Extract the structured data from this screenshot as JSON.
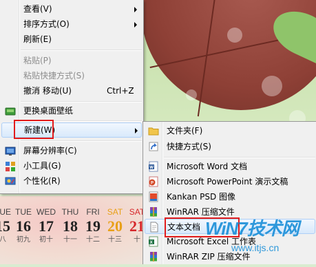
{
  "context_menu": {
    "items": [
      {
        "label": "查看(V)",
        "submenu": true
      },
      {
        "label": "排序方式(O)",
        "submenu": true
      },
      {
        "label": "刷新(E)"
      },
      {
        "label": "粘贴(P)",
        "disabled": true
      },
      {
        "label": "粘贴快捷方式(S)",
        "disabled": true
      },
      {
        "label": "撤消 移动(U)",
        "shortcut": "Ctrl+Z"
      },
      {
        "label": "更换桌面壁纸",
        "icon": "wallpaper-icon"
      },
      {
        "label": "新建(W)",
        "submenu": true,
        "highlighted": true
      },
      {
        "label": "屏幕分辨率(C)",
        "icon": "monitor-icon"
      },
      {
        "label": "小工具(G)",
        "icon": "gadgets-icon"
      },
      {
        "label": "个性化(R)",
        "icon": "personalize-icon"
      }
    ]
  },
  "new_submenu": {
    "items": [
      {
        "label": "文件夹(F)",
        "icon": "folder-icon"
      },
      {
        "label": "快捷方式(S)",
        "icon": "shortcut-icon"
      },
      {
        "label": "Microsoft Word 文档",
        "icon": "word-icon"
      },
      {
        "label": "Microsoft PowerPoint 演示文稿",
        "icon": "powerpoint-icon"
      },
      {
        "label": "Kankan PSD 图像",
        "icon": "psd-icon"
      },
      {
        "label": "WinRAR 压缩文件",
        "icon": "winrar-icon"
      },
      {
        "label": "文本文档",
        "icon": "text-document-icon",
        "highlighted": true
      },
      {
        "label": "Microsoft Excel 工作表",
        "icon": "excel-icon"
      },
      {
        "label": "WinRAR ZIP 压缩文件",
        "icon": "winrar-zip-icon"
      }
    ]
  },
  "calendar": {
    "days": [
      {
        "weekday": "TUE",
        "date": "15",
        "lunar": "八"
      },
      {
        "weekday": "TUE",
        "date": "16",
        "lunar": "初九"
      },
      {
        "weekday": "WED",
        "date": "17",
        "lunar": "初十"
      },
      {
        "weekday": "THU",
        "date": "18",
        "lunar": "十一"
      },
      {
        "weekday": "FRI",
        "date": "19",
        "lunar": "十二"
      },
      {
        "weekday": "SAT",
        "date": "20",
        "lunar": "十三"
      },
      {
        "weekday": "SAT",
        "date": "21",
        "lunar": "十"
      }
    ]
  },
  "watermark": {
    "logo": "WiN7技术网",
    "url": "www.itjs.cn"
  },
  "colors": {
    "highlight_border": "#e21b1b",
    "saturday": "#e8a017",
    "sunday": "#d6262a"
  }
}
